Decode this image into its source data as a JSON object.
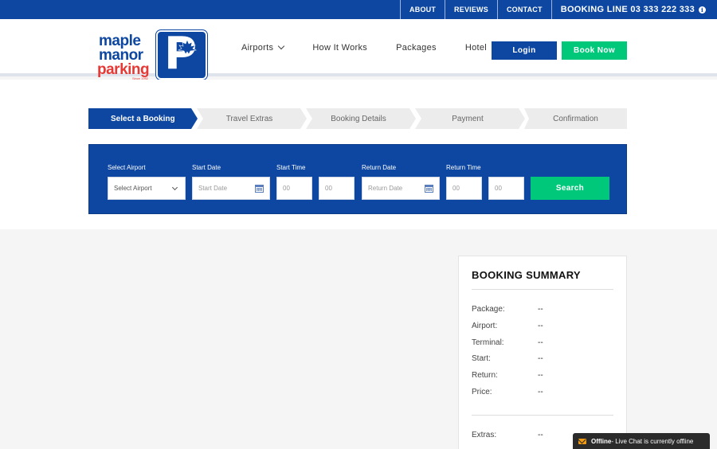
{
  "topbar": {
    "links": [
      "ABOUT",
      "REVIEWS",
      "CONTACT"
    ],
    "booking_line": "BOOKING LINE 03 333 222 333"
  },
  "logo": {
    "line1": "maple",
    "line2": "manor",
    "line3": "parking",
    "since": "Since 1992",
    "letter": "P"
  },
  "nav": {
    "items": [
      "Airports",
      "How It Works",
      "Packages",
      "Hotel"
    ],
    "login": "Login",
    "book_now": "Book Now"
  },
  "steps": [
    "Select a Booking",
    "Travel Extras",
    "Booking Details",
    "Payment",
    "Confirmation"
  ],
  "search": {
    "labels": {
      "airport": "Select Airport",
      "start_date": "Start Date",
      "start_time": "Start Time",
      "return_date": "Return Date",
      "return_time": "Return Time"
    },
    "airport_value": "Select Airport",
    "start_date_placeholder": "Start Date",
    "return_date_placeholder": "Return Date",
    "time_placeholder": "00",
    "button": "Search"
  },
  "summary": {
    "title": "BOOKING SUMMARY",
    "rows": [
      {
        "label": "Package:",
        "value": "--"
      },
      {
        "label": "Airport:",
        "value": "--"
      },
      {
        "label": "Terminal:",
        "value": "--"
      },
      {
        "label": "Start:",
        "value": "--"
      },
      {
        "label": "Return:",
        "value": "--"
      },
      {
        "label": "Price:",
        "value": "--"
      }
    ],
    "extras": {
      "label": "Extras:",
      "value": "--"
    }
  },
  "livechat": {
    "status": "Offline",
    "message": " - Live Chat is currently offline"
  },
  "colors": {
    "brand_blue": "#0d47a1",
    "accent_green": "#00c87a",
    "logo_red": "#e53935"
  }
}
